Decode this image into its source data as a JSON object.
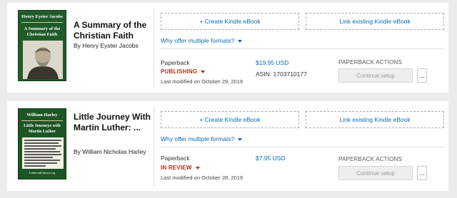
{
  "books": [
    {
      "cover_lines": [
        "Henry Eyster Jacobs",
        "A Summary of the",
        "Christian Faith"
      ],
      "title": "A Summary of the Christian Faith",
      "author": "By Henry Eyster Jacobs",
      "create_kindle": "+ Create Kindle eBook",
      "link_kindle": "Link existing Kindle eBook",
      "why_formats": "Why offer multiple formats?",
      "format": "Paperback",
      "status": "PUBLISHING",
      "last_modified": "Last modified on October 29, 2019",
      "price": "$19.95 USD",
      "asin": "ASIN: 1703710177",
      "actions_label": "PAPERBACK ACTIONS",
      "continue_label": "Continue setup",
      "more_label": "..."
    },
    {
      "cover_lines": [
        "William Harley",
        "Little Journeys with",
        "Martin Luther",
        "LutheranLibrary.org"
      ],
      "title": "Little Journey With Martin Luther: ...",
      "author": "By William Nicholas Harley",
      "create_kindle": "+ Create Kindle eBook",
      "link_kindle": "Link existing Kindle eBook",
      "why_formats": "Why offer multiple formats?",
      "format": "Paperback",
      "status": "IN REVIEW",
      "last_modified": "Last modified on October 28, 2019",
      "price": "$7.95 USD",
      "actions_label": "PAPERBACK ACTIONS",
      "continue_label": "Continue setup",
      "more_label": "..."
    }
  ],
  "colors": {
    "link": "#0c6bb0",
    "status": "#b23414",
    "cover_green": "#1f5c2a"
  }
}
